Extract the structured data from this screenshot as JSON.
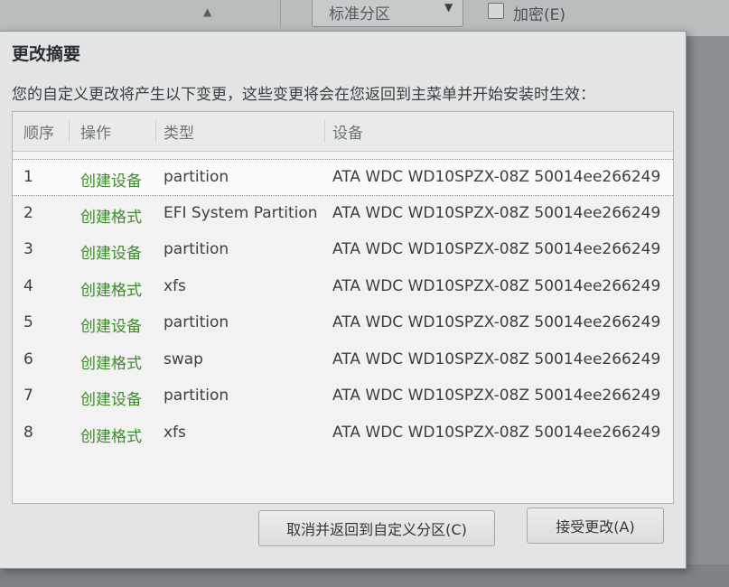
{
  "background": {
    "partition_scheme_dropdown": "标准分区",
    "encrypt_checkbox_label": "加密(E)",
    "encrypt_checked": false
  },
  "dialog": {
    "title": "更改摘要",
    "description": "您的自定义更改将产生以下变更，这些变更将会在您返回到主菜单并开始安装时生效：",
    "table": {
      "columns": [
        "顺序",
        "操作",
        "类型",
        "设备"
      ],
      "rows": [
        {
          "order": "1",
          "action": "创建设备",
          "type": "partition",
          "device": "ATA WDC WD10SPZX-08Z 50014ee266249"
        },
        {
          "order": "2",
          "action": "创建格式",
          "type": "EFI System Partition",
          "device": "ATA WDC WD10SPZX-08Z 50014ee266249"
        },
        {
          "order": "3",
          "action": "创建设备",
          "type": "partition",
          "device": "ATA WDC WD10SPZX-08Z 50014ee266249"
        },
        {
          "order": "4",
          "action": "创建格式",
          "type": "xfs",
          "device": "ATA WDC WD10SPZX-08Z 50014ee266249"
        },
        {
          "order": "5",
          "action": "创建设备",
          "type": "partition",
          "device": "ATA WDC WD10SPZX-08Z 50014ee266249"
        },
        {
          "order": "6",
          "action": "创建格式",
          "type": "swap",
          "device": "ATA WDC WD10SPZX-08Z 50014ee266249"
        },
        {
          "order": "7",
          "action": "创建设备",
          "type": "partition",
          "device": "ATA WDC WD10SPZX-08Z 50014ee266249"
        },
        {
          "order": "8",
          "action": "创建格式",
          "type": "xfs",
          "device": "ATA WDC WD10SPZX-08Z 50014ee266249"
        }
      ]
    },
    "buttons": {
      "cancel": "取消并返回到自定义分区(C)",
      "accept": "接受更改(A)"
    }
  },
  "colors": {
    "action_text": "#3d8a2b",
    "dialog_bg": "#e3e4e5",
    "table_bg": "#f2f2f2"
  }
}
